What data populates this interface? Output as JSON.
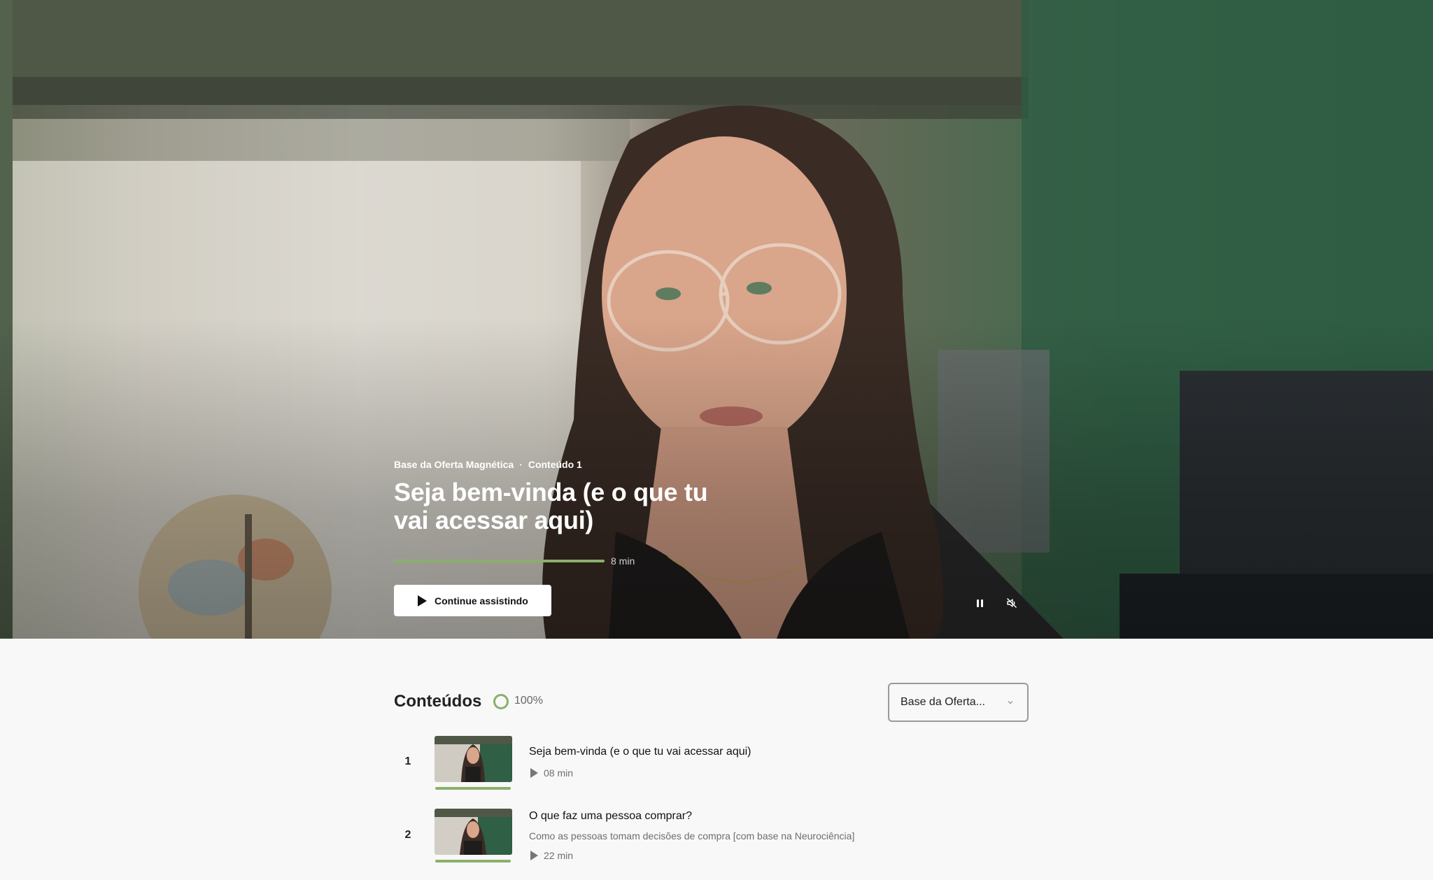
{
  "hero": {
    "breadcrumb_course": "Base da Oferta Magnética",
    "breadcrumb_separator": "·",
    "breadcrumb_item": "Conteúdo 1",
    "title": "Seja bem-vinda (e o que tu vai acessar aqui)",
    "progress_fraction": 1.0,
    "duration": "8 min",
    "continue_label": "Continue assistindo",
    "controls": {
      "pause_icon": "pause-icon",
      "mute_icon": "volume-muted-icon"
    }
  },
  "contents": {
    "title": "Conteúdos",
    "progress_percent": "100%",
    "module_select": "Base da Oferta...",
    "items": [
      {
        "number": "1",
        "title": "Seja bem-vinda (e o que tu vai acessar aqui)",
        "subtitle": "",
        "duration": "08 min",
        "watched_fraction": 1.0
      },
      {
        "number": "2",
        "title": "O que faz uma pessoa comprar?",
        "subtitle": "Como as pessoas tomam decisões de compra [com base na Neurociência]",
        "duration": "22 min",
        "watched_fraction": 1.0
      }
    ]
  },
  "colors": {
    "accent": "#8ab06c",
    "page_background": "#f8f8f8",
    "button_background": "#ffffff"
  }
}
